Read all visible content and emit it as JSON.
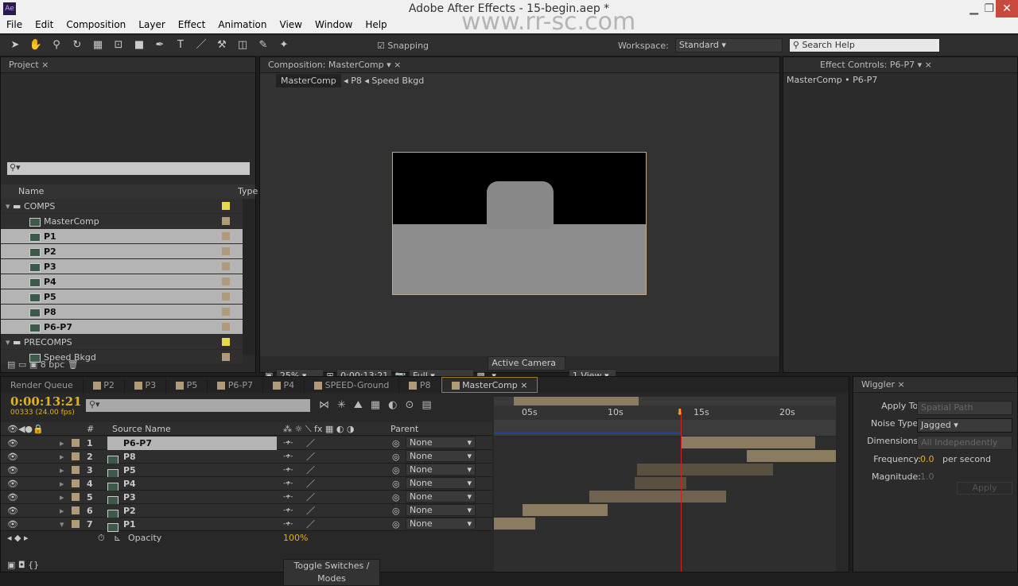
{
  "window": {
    "title": "Adobe After Effects - 15-begin.aep *",
    "watermark": "www.rr-sc.com"
  },
  "menu": [
    "File",
    "Edit",
    "Composition",
    "Layer",
    "Effect",
    "Animation",
    "View",
    "Window",
    "Help"
  ],
  "toolbar": {
    "snapping": "Snapping",
    "workspace_label": "Workspace:",
    "workspace": "Standard",
    "search_placeholder": "Search Help"
  },
  "project": {
    "tab": "Project",
    "col_name": "Name",
    "col_type": "Type",
    "bpc": "8 bpc",
    "items": [
      {
        "name": "COMPS",
        "folder": true,
        "swatch": "yellow"
      },
      {
        "name": "MasterComp",
        "swatch": "tan"
      },
      {
        "name": "P1",
        "selected": true
      },
      {
        "name": "P2",
        "selected": true
      },
      {
        "name": "P3",
        "selected": true
      },
      {
        "name": "P4",
        "selected": true
      },
      {
        "name": "P5",
        "selected": true
      },
      {
        "name": "P8",
        "selected": true
      },
      {
        "name": "P6-P7",
        "selected": true
      },
      {
        "name": "PRECOMPS",
        "folder": true,
        "swatch": "yellow"
      },
      {
        "name": "Speed Bkgd"
      }
    ]
  },
  "composition": {
    "tab": "Composition: MasterComp",
    "breadcrumbs": [
      "MasterComp",
      "P8",
      "Speed Bkgd"
    ],
    "zoom": "25%",
    "timecode": "0:00:13:21",
    "resolution": "Full",
    "camera": "Active Camera",
    "views": "1 View"
  },
  "effect_controls": {
    "tab": "Effect Controls: P6-P7",
    "path": "MasterComp • P6-P7"
  },
  "timeline": {
    "tabs": [
      "Render Queue",
      "P2",
      "P3",
      "P5",
      "P6-P7",
      "P4",
      "SPEED-Ground",
      "P8",
      "MasterComp"
    ],
    "active_tab": "MasterComp",
    "timecode": "0:00:13:21",
    "frames": "00333 (24.00 fps)",
    "col_hash": "#",
    "col_source": "Source Name",
    "col_parent": "Parent",
    "ruler": [
      "05s",
      "10s",
      "15s",
      "20s"
    ],
    "layers": [
      {
        "num": "1",
        "name": "P6-P7",
        "parent": "None"
      },
      {
        "num": "2",
        "name": "P8",
        "parent": "None"
      },
      {
        "num": "3",
        "name": "P5",
        "parent": "None"
      },
      {
        "num": "4",
        "name": "P4",
        "parent": "None"
      },
      {
        "num": "5",
        "name": "P3",
        "parent": "None"
      },
      {
        "num": "6",
        "name": "P2",
        "parent": "None"
      },
      {
        "num": "7",
        "name": "P1",
        "parent": "None"
      }
    ],
    "property": {
      "name": "Opacity",
      "value": "100%"
    },
    "toggle": "Toggle Switches / Modes"
  },
  "wiggler": {
    "tab": "Wiggler",
    "apply_to_label": "Apply To:",
    "apply_to": "Spatial Path",
    "noise_label": "Noise Type:",
    "noise": "Jagged",
    "dim_label": "Dimensions:",
    "dim": "All Independently",
    "freq_label": "Frequency:",
    "freq": "0.0",
    "freq_unit": "per second",
    "mag_label": "Magnitude:",
    "mag": "1.0",
    "apply": "Apply"
  },
  "colors": {
    "accent": "#e0b020",
    "playhead": "#d02020",
    "label_tan": "#b09a78"
  }
}
